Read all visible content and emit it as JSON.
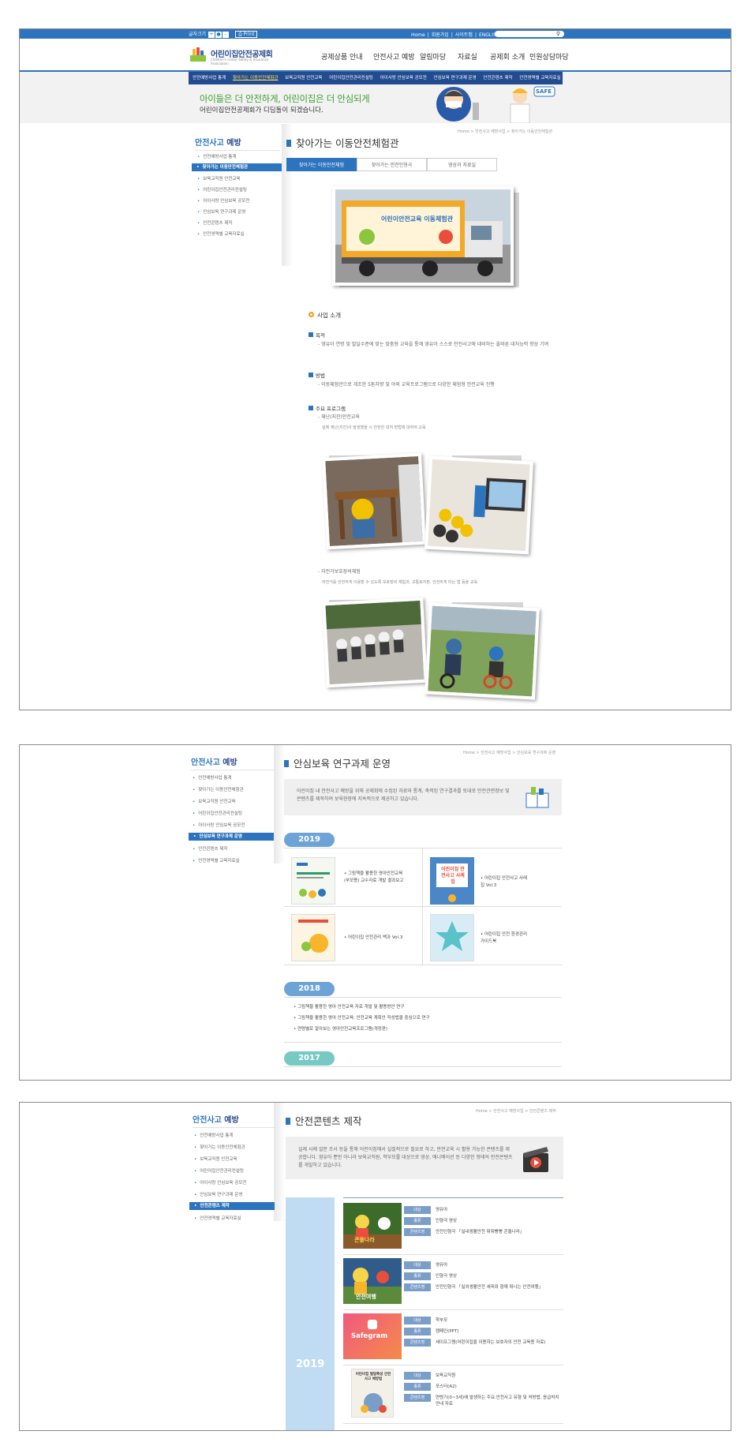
{
  "topbar": {
    "font_label": "글자크기",
    "font_btns": [
      "+",
      "●",
      "-"
    ],
    "print": "Print",
    "links": [
      "Home",
      "회원가입",
      "사이트맵",
      "ENGLISH"
    ]
  },
  "header": {
    "logo_text": "어린이집안전공제회",
    "logo_sub": "Children's center Safety & Insurance Association",
    "gnb": [
      "공제상품 안내",
      "안전사고 예방",
      "알림마당",
      "자료실",
      "공제회 소개",
      "민원상담마당"
    ]
  },
  "subnav": [
    "안전예방사업 통계",
    "찾아가는 이동안전체험관",
    "보육교직원 안전교육",
    "어린이집안전관리컨설팅",
    "아이사랑 안심보육 공모전",
    "안심보육 연구과제 운영",
    "안전콘텐츠 제작",
    "안전영역별 교육자료실"
  ],
  "banner": {
    "line1": "아이들은 더 안전하게, 어린이집은 더 안심되게",
    "line2": "어린이집안전공제회가 디딤돌이 되겠습니다.",
    "safe": "SAFE"
  },
  "lnb": {
    "title_a": "안전사고",
    "title_b": " 예방",
    "items": [
      "안전예방사업 통계",
      "찾아가는 이동안전체험관",
      "보육교직원 안전교육",
      "어린이집안전관리컨설팅",
      "아이사랑 안심보육 공모전",
      "안심보육 연구과제 운영",
      "안전콘텐츠 제작",
      "안전영역별 교육자료실"
    ]
  },
  "page1": {
    "title": "찾아가는 이동안전체험관",
    "crumb": "Home > 안전사고 예방사업 > 찾아가는 이동안전체험관",
    "tabs": [
      "찾아가는 이동안전체험",
      "찾아가는 안전인형극",
      "영상과 자료실"
    ],
    "truck_text": "어린이안전교육 이동체험관",
    "intro_h": "사업 소개",
    "purpose_h": "목적",
    "purpose_t": "- 영유아 연령 및 발달수준에 맞는 맞춤형 교육을 통해 영유아 스스로 안전사고에 대비하는 올바른 대처능력  향상 기여",
    "method_h": "방법",
    "method_t": "- 이동체험관으로 개조한 5톤차량 및 야외 교육프로그램으로 다양한 체험형 안전교육 진행",
    "prog_h": "주요 프로그램",
    "prog1": "- 재난(지진)안전교육",
    "prog1_s": "실제 재난(지진)이 발생했을 시 안전한 대처 방법에 대하여 교육",
    "prog2": "- 자전거보호장비체험",
    "prog2_s": "자전거를 안전하게 이용할 수 있도록 보호장비 체험과, 교통표지판, 안전하게 타는 법 등을 교육"
  },
  "page2": {
    "title": "안심보육 연구과제 운영",
    "crumb": "Home > 안전사고 예방사업 > 안심보육 연구과제 운영",
    "intro": "어린이집 내 안전사고 예방을 위해 공제회에 수집된 자료와 통계, 축적된 연구결과를 토대로 안전관련정보 및 콘텐츠를 제작하여 보육현장에 지속적으로 제공하고 있습니다.",
    "years": [
      "2019",
      "2018",
      "2017"
    ],
    "items2019": [
      "그림책을 활용한 영아안전교육 (부모용) 교수자료 개발 결과보고",
      "어린이집 안전사고 사례집 Vol.3",
      "어린이집 안전관리 백과 Vol.3",
      "어린이집 안전 환경관리 가이드북"
    ],
    "book_cover": "어린이집 안전사고 사례집",
    "items2018": [
      "그림책을 활용한 영아 안전교육 자료 개발 및 활용방안 연구",
      "그림책을 활용한 영아 안전교육: 안전교육 계획안 작성법을 중심으로 연구",
      "연령별로 알아보는 영아안전교육프로그램(개정판)"
    ]
  },
  "page3": {
    "title": "안전콘텐츠 제작",
    "crumb": "Home > 안전사고 예방사업 > 안전콘텐츠 제작",
    "intro": "실제 사례 설문 조사 등을 통해 어린이집에서 실질적으로 필요로 하고, 안전교육 시 활용 가능한 콘텐츠를 제공합니다. 영유아 뿐만 아니라 보육교직원, 학부모를 대상으로 영상, 애니메이션 등 다양한 형태의 안전콘텐츠를 개발하고 있습니다.",
    "year": "2019",
    "tags": [
      "대상",
      "종류",
      "콘텐츠명"
    ],
    "rows": [
      {
        "target": "영유아",
        "kind": "인형극 영상",
        "name": "안전인형극 「실내생활안전 뛰뛰빵빵 콘돌나라」",
        "thumb": "콘돌나라"
      },
      {
        "target": "영유아",
        "kind": "인형극 영상",
        "name": "안전인형극 「실외생활안전 세피와 함께 뛰나는 안전여행」",
        "thumb": "안전여행"
      },
      {
        "target": "학부모",
        "kind": "캠페인(PPT)",
        "name": "세이프그램(어린이집을 이용하는 보호자의 안전 교육용 자료)",
        "thumb": "Safegram"
      },
      {
        "target": "보육교직원",
        "kind": "포스터(A2)",
        "name": "연령기(0~3세)에 발생하는 주요 안전사고 유형 및 처방법, 응급처치 안내 자료",
        "thumb": "어린이집 발달특성 안전사고 예방법"
      }
    ]
  }
}
